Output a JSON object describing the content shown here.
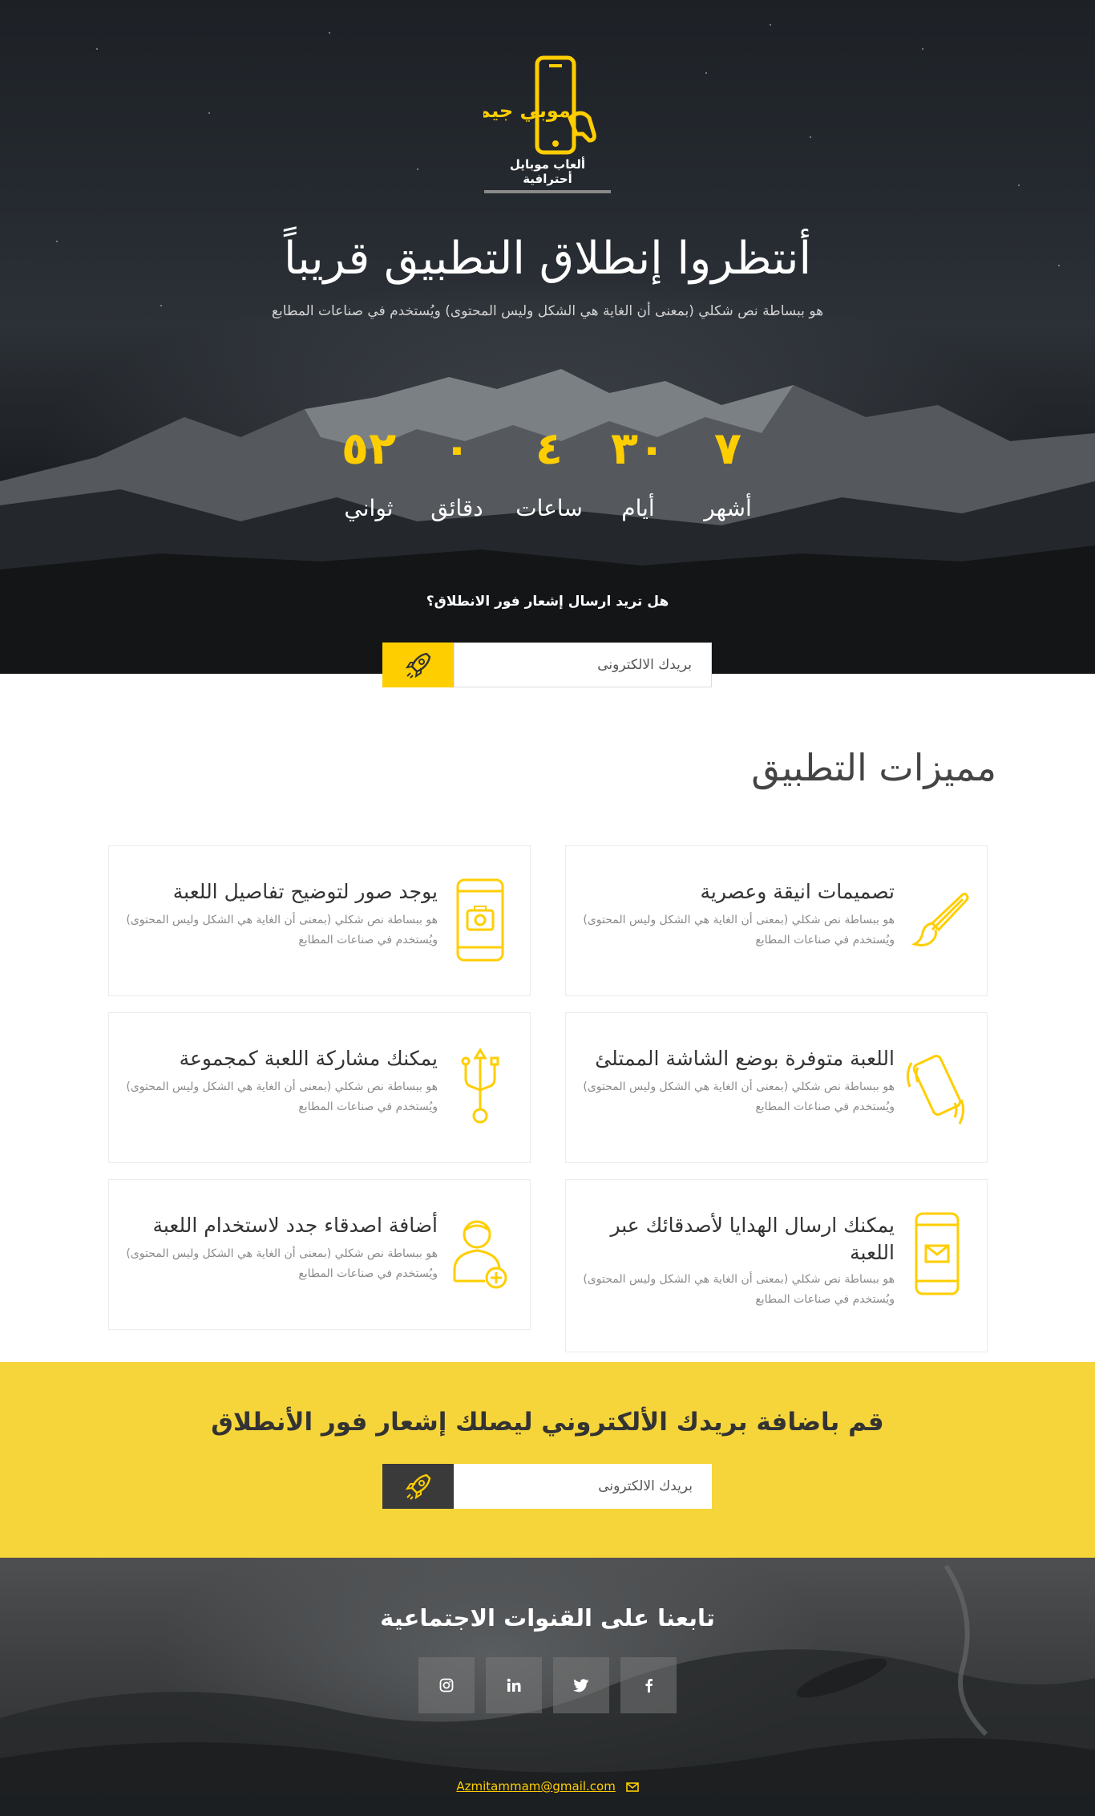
{
  "brand": {
    "name": "موبي جيم",
    "tagline": "ألعاب موبايل أحترافية",
    "accent_color": "#ffce00",
    "cta_background": "#f6d53a"
  },
  "hero": {
    "title": "أنتظروا إنطلاق التطبيق قريباً",
    "subtitle": "هو ببساطة نص شكلي (بمعنى أن الغاية هي الشكل وليس المحتوى) ويُستخدم في صناعات المطابع",
    "countdown": [
      {
        "value": "٧",
        "label": "أشهر"
      },
      {
        "value": "٣٠",
        "label": "أيام"
      },
      {
        "value": "٤",
        "label": "ساعات"
      },
      {
        "value": "٠",
        "label": "دقائق"
      },
      {
        "value": "٥٢",
        "label": "ثواني"
      }
    ],
    "notify_question": "هل تريد ارسال إشعار فور الانطلاق؟",
    "email_placeholder": "بريدك الالكترونى",
    "submit_icon": "rocket-icon"
  },
  "features": {
    "title": "مميزات التطبيق",
    "items": [
      {
        "title": "تصميمات انيقة وعصرية",
        "text": "هو ببساطة نص شكلي (بمعنى أن الغاية هي الشكل وليس المحتوى) ويُستخدم في صناعات المطابع",
        "icon": "paintbrush-icon"
      },
      {
        "title": "يوجد صور لتوضيح تفاصيل اللعبة",
        "text": "هو ببساطة نص شكلي (بمعنى أن الغاية هي الشكل وليس المحتوى) ويُستخدم في صناعات المطابع",
        "icon": "phone-camera-icon"
      },
      {
        "title": "اللعبة متوفرة بوضع الشاشة الممتلئ",
        "text": "هو ببساطة نص شكلي (بمعنى أن الغاية هي الشكل وليس المحتوى) ويُستخدم في صناعات المطابع",
        "icon": "phone-vibrate-icon"
      },
      {
        "title": "يمكنك مشاركة اللعبة كمجموعة",
        "text": "هو ببساطة نص شكلي (بمعنى أن الغاية هي الشكل وليس المحتوى) ويُستخدم في صناعات المطابع",
        "icon": "usb-share-icon"
      },
      {
        "title": "يمكنك ارسال الهدايا لأصدقائك عبر اللعبة",
        "text": "هو ببساطة نص شكلي (بمعنى أن الغاية هي الشكل وليس المحتوى) ويُستخدم في صناعات المطابع",
        "icon": "phone-mail-icon"
      },
      {
        "title": "أضافة اصدقاء جدد لاستخدام اللعبة",
        "text": "هو ببساطة نص شكلي (بمعنى أن الغاية هي الشكل وليس المحتوى) ويُستخدم في صناعات المطابع",
        "icon": "add-friend-icon"
      }
    ]
  },
  "cta": {
    "title": "قم باضافة بريدك الألكتروني ليصلك إشعار فور الأنطلاق",
    "email_placeholder": "بريدك الالكترونى",
    "submit_icon": "rocket-icon"
  },
  "footer": {
    "title": "تابعنا على القنوات الاجتماعية",
    "socials": [
      "instagram-icon",
      "linkedin-icon",
      "twitter-icon",
      "facebook-icon"
    ],
    "email": "Azmitammam@gmail.com",
    "email_icon": "envelope-icon"
  }
}
